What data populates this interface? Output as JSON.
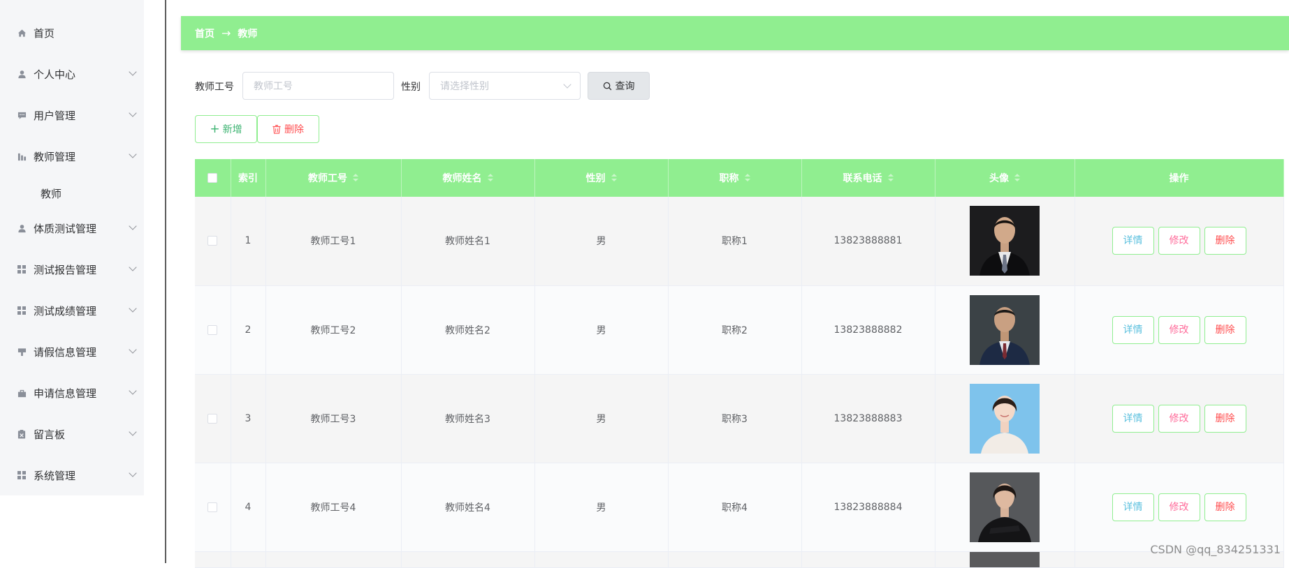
{
  "sidebar": {
    "items": [
      {
        "label": "首页",
        "icon": "home-icon"
      },
      {
        "label": "个人中心",
        "icon": "user-icon"
      },
      {
        "label": "用户管理",
        "icon": "chat-icon"
      },
      {
        "label": "教师管理",
        "icon": "chart-icon"
      },
      {
        "label": "体质测试管理",
        "icon": "user-icon"
      },
      {
        "label": "测试报告管理",
        "icon": "grid-icon"
      },
      {
        "label": "测试成绩管理",
        "icon": "grid-icon"
      },
      {
        "label": "请假信息管理",
        "icon": "flag-icon"
      },
      {
        "label": "申请信息管理",
        "icon": "cart-icon"
      },
      {
        "label": "留言板",
        "icon": "clipboard-icon"
      },
      {
        "label": "系统管理",
        "icon": "grid-icon"
      }
    ],
    "submenu_label": "教师"
  },
  "breadcrumb": {
    "home": "首页",
    "separator": "→",
    "current": "教师"
  },
  "filters": {
    "teacher_id_label": "教师工号",
    "teacher_id_placeholder": "教师工号",
    "gender_label": "性别",
    "gender_placeholder": "请选择性别",
    "query_label": "查询"
  },
  "toolbar": {
    "add_label": "新增",
    "delete_label": "删除"
  },
  "table": {
    "columns": [
      "索引",
      "教师工号",
      "教师姓名",
      "性别",
      "职称",
      "联系电话",
      "头像",
      "操作"
    ],
    "rows": [
      {
        "index": "1",
        "teacher_id": "教师工号1",
        "name": "教师姓名1",
        "gender": "男",
        "title": "职称1",
        "phone": "13823888881",
        "avatar": "portrait-man-black-suit"
      },
      {
        "index": "2",
        "teacher_id": "教师工号2",
        "name": "教师姓名2",
        "gender": "男",
        "title": "职称2",
        "phone": "13823888882",
        "avatar": "portrait-man-navy-suit"
      },
      {
        "index": "3",
        "teacher_id": "教师工号3",
        "name": "教师姓名3",
        "gender": "男",
        "title": "职称3",
        "phone": "13823888883",
        "avatar": "portrait-woman-blue-background"
      },
      {
        "index": "4",
        "teacher_id": "教师工号4",
        "name": "教师姓名4",
        "gender": "男",
        "title": "职称4",
        "phone": "13823888884",
        "avatar": "portrait-woman-black-jacket"
      }
    ],
    "actions": {
      "detail": "详情",
      "edit": "修改",
      "delete": "删除"
    }
  },
  "watermark": "CSDN @qq_834251331",
  "colors": {
    "accent_green": "#90ee90",
    "detail_text": "#5bc0de",
    "edit_text": "#ff6b9a",
    "delete_text": "#ff4d4f",
    "add_text": "#3cb371"
  }
}
